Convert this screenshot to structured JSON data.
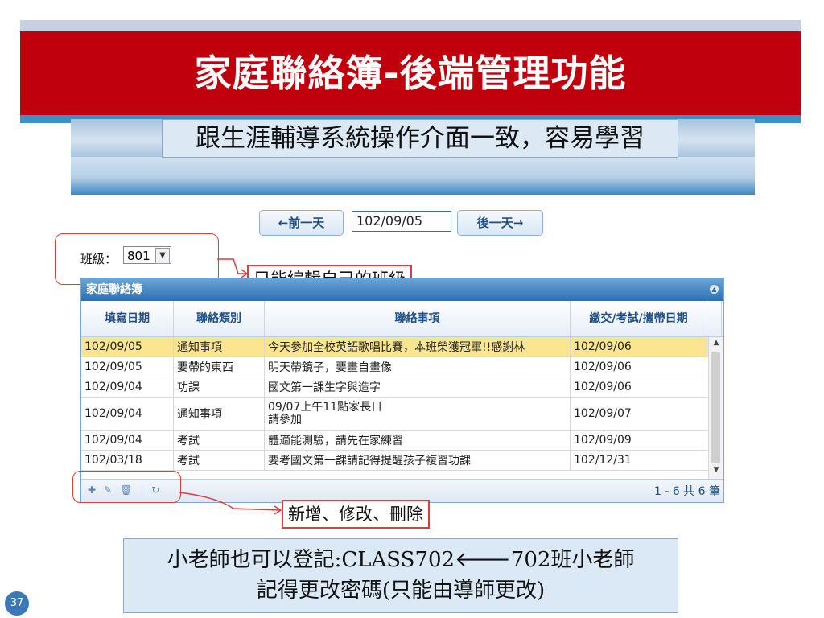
{
  "slide": {
    "title": "家庭聯絡簿-後端管理功能",
    "subtitle": "跟生涯輔導系統操作介面一致，容易學習",
    "page_number": "37",
    "note_line1": "小老師也可以登記:CLASS702🡐702班小老師",
    "note_line2": "記得更改密碼(只能由導師更改)"
  },
  "toolbar": {
    "prev_day_label": "←前一天",
    "date_value": "102/09/05",
    "next_day_label": "後一天→",
    "class_label": "班級：",
    "class_value": "801"
  },
  "callouts": {
    "class_note": "只能編輯自己的班級",
    "crud_note": "新增、修改、刪除"
  },
  "grid": {
    "caption": "家庭聯絡簿",
    "columns": [
      "填寫日期",
      "聯絡類別",
      "聯絡事項",
      "繳交/考試/攜帶日期"
    ],
    "rows": [
      {
        "date": "102/09/05",
        "category": "通知事項",
        "content": "今天參加全校英語歌唱比賽，本班榮獲冠軍!!感謝林",
        "due": "102/09/06",
        "highlight": true
      },
      {
        "date": "102/09/05",
        "category": "要帶的東西",
        "content": "明天帶鏡子，要畫自畫像",
        "due": "102/09/06"
      },
      {
        "date": "102/09/04",
        "category": "功課",
        "content": "國文第一課生字與造字",
        "due": "102/09/06"
      },
      {
        "date": "102/09/04",
        "category": "通知事項",
        "content": "09/07上午11點家長日\n請參加",
        "due": "102/09/07"
      },
      {
        "date": "102/09/04",
        "category": "考試",
        "content": "體適能測驗，請先在家練習",
        "due": "102/09/09"
      },
      {
        "date": "102/03/18",
        "category": "考試",
        "content": "要考國文第一課請記得提醒孩子複習功課",
        "due": "102/12/31"
      }
    ],
    "pager": "1 - 6  共 6 筆"
  },
  "colors": {
    "title_bar": "#c0000c",
    "highlight_row": "#fbe591",
    "callout": "#e03a3a"
  }
}
